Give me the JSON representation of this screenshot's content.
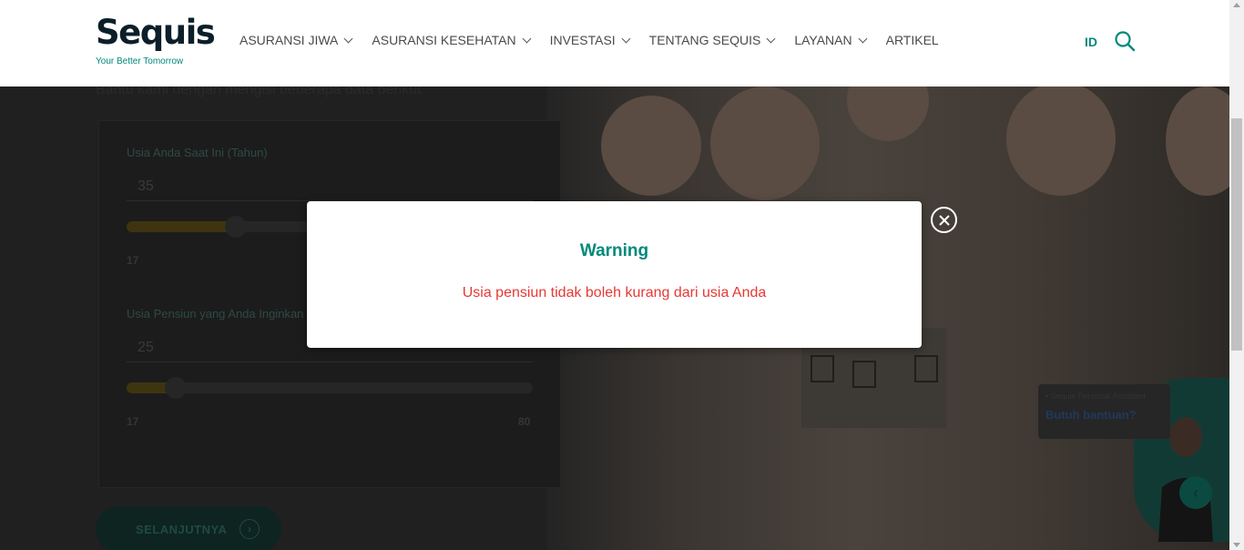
{
  "header": {
    "logo_text": "Sequis",
    "logo_tagline": "Your Better Tomorrow",
    "nav": [
      {
        "label": "ASURANSI JIWA",
        "has_dropdown": true
      },
      {
        "label": "ASURANSI KESEHATAN",
        "has_dropdown": true
      },
      {
        "label": "INVESTASI",
        "has_dropdown": true
      },
      {
        "label": "TENTANG SEQUIS",
        "has_dropdown": true
      },
      {
        "label": "LAYANAN",
        "has_dropdown": true
      },
      {
        "label": "ARTIKEL",
        "has_dropdown": false
      }
    ],
    "language": "ID",
    "search_icon": "search-icon"
  },
  "form": {
    "intro": "Bantu kami dengan mengisi beberapa data berikut",
    "current_age": {
      "label": "Usia Anda Saat Ini (Tahun)",
      "value": "35",
      "min_label": "17",
      "fill_fraction": 0.27
    },
    "retirement_age": {
      "label": "Usia Pensiun yang Anda Inginkan",
      "value": "25",
      "min_label": "17",
      "max_label": "80",
      "fill_fraction": 0.12
    },
    "next_button": "SELANJUTNYA"
  },
  "assistant": {
    "small_label": "• Sequis Personal Assistant",
    "prompt": "Butuh bantuan?"
  },
  "modal": {
    "title": "Warning",
    "message": "Usia pensiun tidak boleh kurang dari usia Anda",
    "close_icon": "close-circle-icon"
  },
  "colors": {
    "brand_teal": "#00897b",
    "warning_red": "#e53935",
    "slider_gold": "#f5b400"
  }
}
